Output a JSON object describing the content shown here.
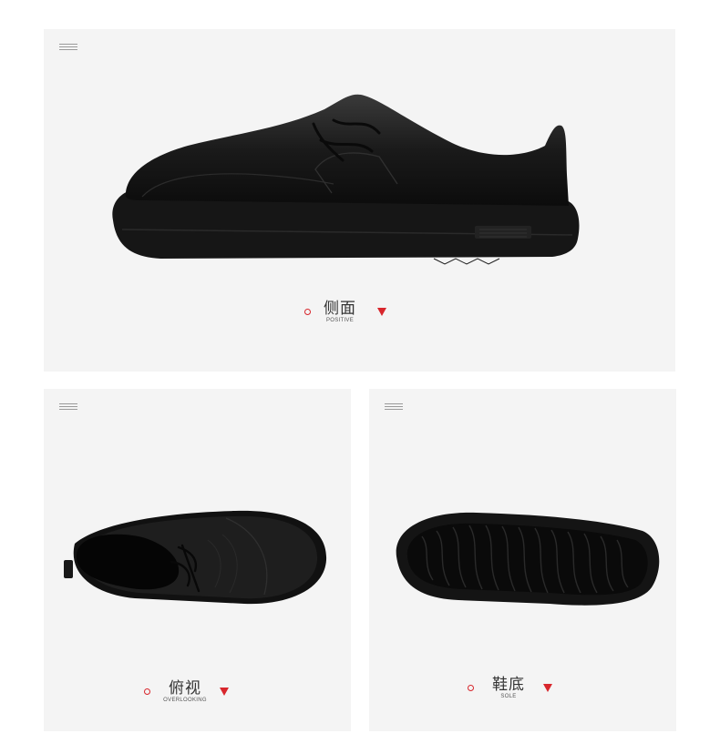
{
  "views": [
    {
      "title": "侧面",
      "subtitle": "POSITIVE",
      "icon": "hamburger-icon"
    },
    {
      "title": "俯视",
      "subtitle": "OVERLOOKING",
      "icon": "hamburger-icon"
    },
    {
      "title": "鞋底",
      "subtitle": "SOLE",
      "icon": "hamburger-icon"
    }
  ],
  "colors": {
    "panel": "#f4f4f4",
    "accent": "#d8262c",
    "shoe": "#141414"
  }
}
